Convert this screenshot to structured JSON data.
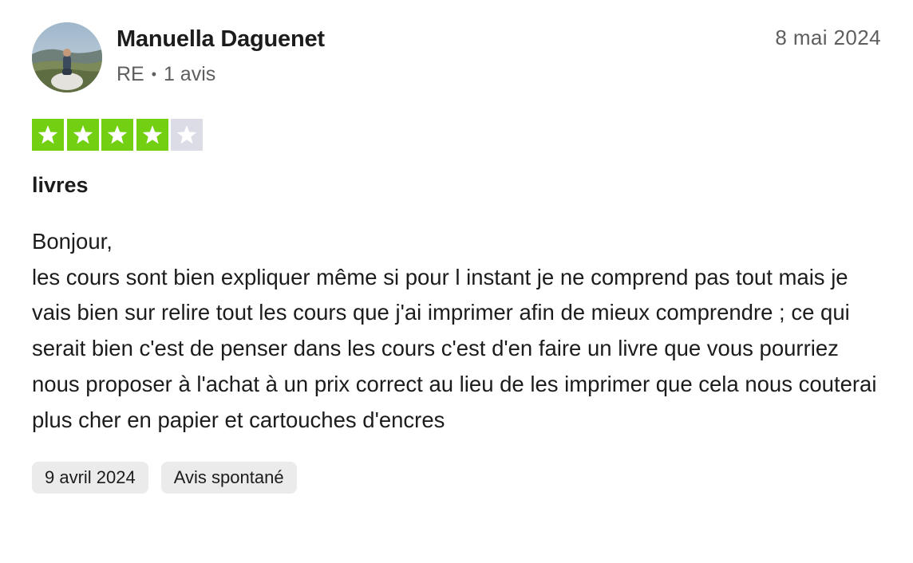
{
  "user": {
    "name": "Manuella Daguenet",
    "country": "RE",
    "separator": "•",
    "review_count": "1 avis"
  },
  "review": {
    "published_date": "8 mai 2024",
    "rating": 4,
    "rating_max": 5,
    "star_on_color": "#73cf11",
    "star_off_color": "#dcdce6",
    "title": "livres",
    "body": "Bonjour,\nles cours sont bien expliquer même si pour l instant je ne comprend pas tout mais je vais bien sur relire tout les cours que j'ai imprimer afin de mieux comprendre ; ce qui serait bien c'est de penser dans les cours c'est d'en faire un livre que vous pourriez nous proposer à l'achat à un prix correct au lieu de les imprimer que cela nous couterai plus cher en papier et cartouches d'encres"
  },
  "tags": {
    "experience_date": "9 avril 2024",
    "review_type": "Avis spontané"
  },
  "icons": {
    "star": "star-icon",
    "avatar": "user-avatar-photo"
  }
}
